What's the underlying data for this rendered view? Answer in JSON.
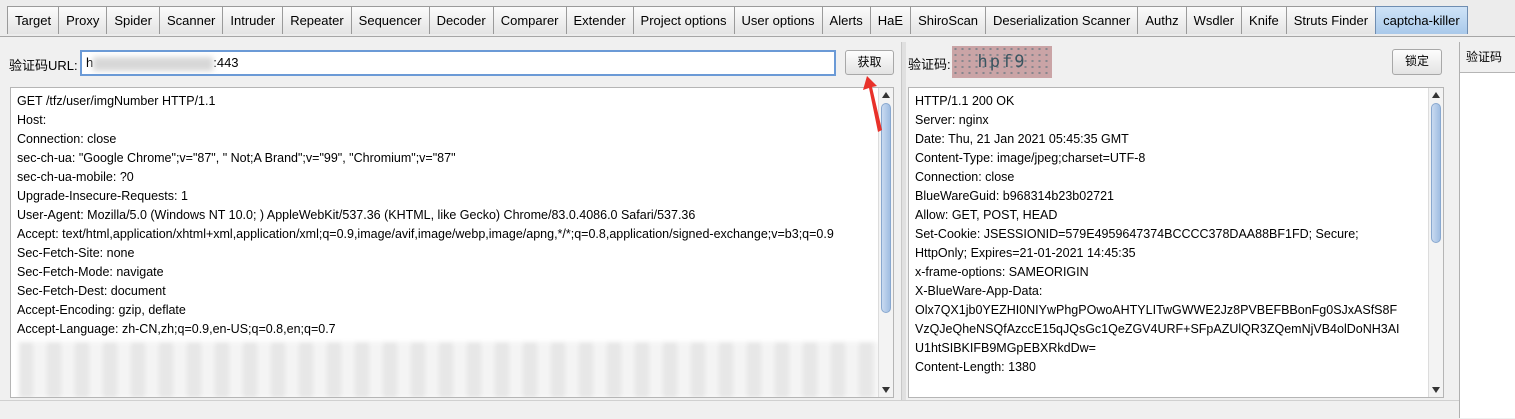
{
  "tabs": [
    "Target",
    "Proxy",
    "Spider",
    "Scanner",
    "Intruder",
    "Repeater",
    "Sequencer",
    "Decoder",
    "Comparer",
    "Extender",
    "Project options",
    "User options",
    "Alerts",
    "HaE",
    "ShiroScan",
    "Deserialization Scanner",
    "Authz",
    "Wsdler",
    "Knife",
    "Struts Finder",
    "captcha-killer"
  ],
  "active_tab": "captcha-killer",
  "left": {
    "url_label": "验证码URL:",
    "url_prefix": "h",
    "url_suffix": ":443",
    "fetch_button": "获取",
    "request_lines": [
      "GET /tfz/user/imgNumber HTTP/1.1",
      "Host:",
      "Connection: close",
      "sec-ch-ua: \"Google Chrome\";v=\"87\", \" Not;A Brand\";v=\"99\", \"Chromium\";v=\"87\"",
      "sec-ch-ua-mobile: ?0",
      "Upgrade-Insecure-Requests: 1",
      "User-Agent: Mozilla/5.0 (Windows NT 10.0; ) AppleWebKit/537.36 (KHTML, like Gecko) Chrome/83.0.4086.0 Safari/537.36",
      "Accept: text/html,application/xhtml+xml,application/xml;q=0.9,image/avif,image/webp,image/apng,*/*;q=0.8,application/signed-exchange;v=b3;q=0.9",
      "Sec-Fetch-Site: none",
      "Sec-Fetch-Mode: navigate",
      "Sec-Fetch-Dest: document",
      "Accept-Encoding: gzip, deflate",
      "Accept-Language: zh-CN,zh;q=0.9,en-US;q=0.8,en;q=0.7"
    ]
  },
  "middle": {
    "captcha_label": "验证码:",
    "captcha_text": "hpf9",
    "lock_button": "锁定",
    "response_lines": [
      "HTTP/1.1 200 OK",
      "Server: nginx",
      "Date: Thu, 21 Jan 2021 05:45:35 GMT",
      "Content-Type: image/jpeg;charset=UTF-8",
      "Connection: close",
      "BlueWareGuid: b968314b23b02721",
      "Allow: GET, POST, HEAD",
      "Set-Cookie: JSESSIONID=579E4959647374BCCCC378DAA88BF1FD; Secure;",
      "HttpOnly; Expires=21-01-2021 14:45:35",
      "x-frame-options: SAMEORIGIN",
      "X-BlueWare-App-Data:",
      "Olx7QX1jb0YEZHI0NIYwPhgPOwoAHTYLITwGWWE2Jz8PVBEFBBonFg0SJxASfS8F",
      "VzQJeQheNSQfAzccE15qJQsGc1QeZGV4URF+SFpAZUlQR3ZQemNjVB4olDoNH3AI",
      "U1htSIBKIFB9MGpEBXRkdDw=",
      "Content-Length: 1380"
    ]
  },
  "right": {
    "header": "验证码"
  },
  "colors": {
    "active_tab": "#a9c9ea",
    "captcha_bg": "#caa4a6",
    "arrow": "#e8312a"
  }
}
